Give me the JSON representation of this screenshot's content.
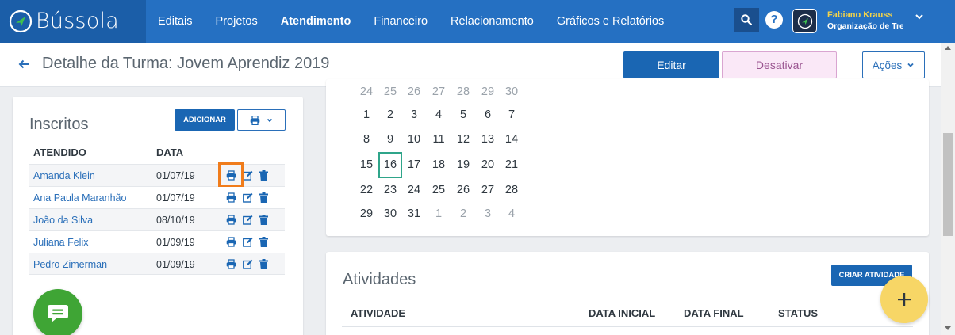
{
  "app": {
    "brand": "Bússola",
    "nav": [
      "Editais",
      "Projetos",
      "Atendimento",
      "Financeiro",
      "Relacionamento",
      "Gráficos e Relatórios"
    ],
    "active_nav": "Atendimento",
    "user_name": "Fabiano Krauss",
    "user_org": "Organização de Tre",
    "icons": {
      "search": "search-icon",
      "help": "help-icon",
      "caret": "chevron-down-icon"
    }
  },
  "header": {
    "title": "Detalhe da Turma: Jovem Aprendiz 2019",
    "edit_label": "Editar",
    "deactivate_label": "Desativar",
    "actions_label": "Ações"
  },
  "enrolled": {
    "title": "Inscritos",
    "add_label": "ADICIONAR",
    "columns": [
      "ATENDIDO",
      "DATA"
    ],
    "rows": [
      {
        "name": "Amanda Klein",
        "date": "01/07/19"
      },
      {
        "name": "Ana Paula Maranhão",
        "date": "01/07/19"
      },
      {
        "name": "João da Silva",
        "date": "08/10/19"
      },
      {
        "name": "Juliana Felix",
        "date": "01/09/19"
      },
      {
        "name": "Pedro Zimerman",
        "date": "01/09/19"
      }
    ]
  },
  "calendar": {
    "weeks": [
      [
        "24",
        "25",
        "26",
        "27",
        "28",
        "29",
        "30"
      ],
      [
        "1",
        "2",
        "3",
        "4",
        "5",
        "6",
        "7"
      ],
      [
        "8",
        "9",
        "10",
        "11",
        "12",
        "13",
        "14"
      ],
      [
        "15",
        "16",
        "17",
        "18",
        "19",
        "20",
        "21"
      ],
      [
        "22",
        "23",
        "24",
        "25",
        "26",
        "27",
        "28"
      ],
      [
        "29",
        "30",
        "31",
        "1",
        "2",
        "3",
        "4"
      ]
    ],
    "selected_day": "16"
  },
  "activities": {
    "title": "Atividades",
    "create_label": "CRIAR ATIVIDADE",
    "columns": [
      "ATIVIDADE",
      "DATA INICIAL",
      "DATA FINAL",
      "STATUS"
    ]
  },
  "colors": {
    "nav_bg": "#2570c2",
    "primary": "#1a66b3",
    "link": "#2a6fb9",
    "highlight": "#f07c1b",
    "today_border": "#2fa58a",
    "chat_fab": "#3fa535",
    "add_fab": "#f7d666"
  }
}
